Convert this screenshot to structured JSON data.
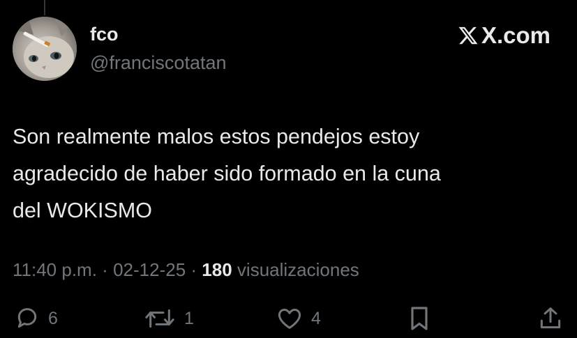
{
  "user": {
    "display_name": "fco",
    "handle": "@franciscotatan"
  },
  "brand": {
    "text": "X.com"
  },
  "tweet": {
    "text": "Son realmente malos estos pendejos estoy\nagradecido de haber sido formado en la cuna\ndel WOKISMO"
  },
  "meta": {
    "time": "11:40 p.m.",
    "separator": "·",
    "date": "02-12-25",
    "views_count": "180",
    "views_label": "visualizaciones"
  },
  "actions": {
    "replies": "6",
    "reposts": "1",
    "likes": "4"
  },
  "icons": {
    "reply": "reply-icon",
    "repost": "repost-icon",
    "like": "heart-icon",
    "bookmark": "bookmark-icon",
    "share": "share-icon",
    "brand": "x-logo-icon"
  },
  "colors": {
    "background": "#000000",
    "primary_text": "#e7e9ea",
    "secondary_text": "#71767b"
  }
}
